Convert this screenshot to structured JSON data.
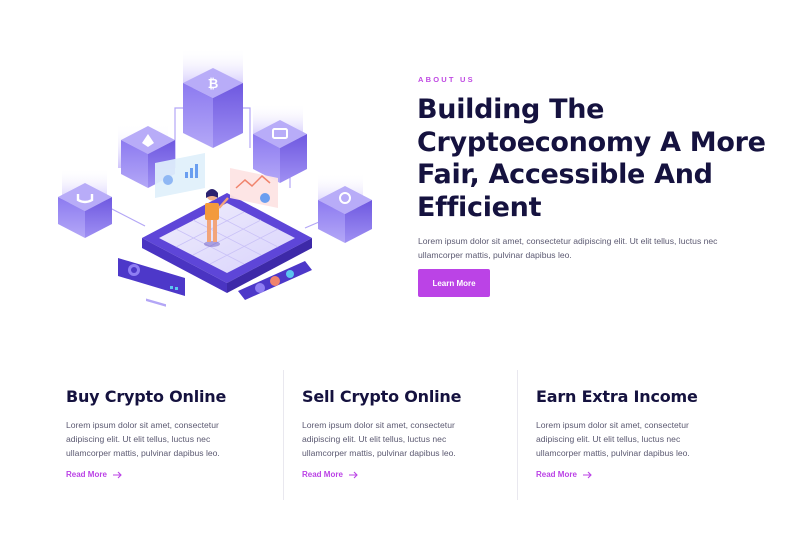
{
  "hero": {
    "eyebrow": "ABOUT US",
    "title": "Building The Cryptoeconomy A More Fair, Accessible And Efficient",
    "description": "Lorem ipsum dolor sit amet, consectetur adipiscing elit. Ut elit tellus, luctus nec ullamcorper mattis, pulvinar dapibus leo.",
    "button_label": "Learn More",
    "illustration_icon": "isometric-crypto-illustration"
  },
  "features": [
    {
      "title": "Buy Crypto Online",
      "text": "Lorem ipsum dolor sit amet, consectetur adipiscing elit. Ut elit tellus, luctus nec ullamcorper mattis, pulvinar dapibus leo.",
      "link_label": "Read More"
    },
    {
      "title": "Sell Crypto Online",
      "text": "Lorem ipsum dolor sit amet, consectetur adipiscing elit. Ut elit tellus, luctus nec ullamcorper mattis, pulvinar dapibus leo.",
      "link_label": "Read More"
    },
    {
      "title": "Earn Extra Income",
      "text": "Lorem ipsum dolor sit amet, consectetur adipiscing elit. Ut elit tellus, luctus nec ullamcorper mattis, pulvinar dapibus leo.",
      "link_label": "Read More"
    }
  ],
  "colors": {
    "accent": "#bb43e6",
    "heading": "#15123f",
    "body_text": "#5c5a72",
    "illustration_purple": "#7b63e8"
  }
}
